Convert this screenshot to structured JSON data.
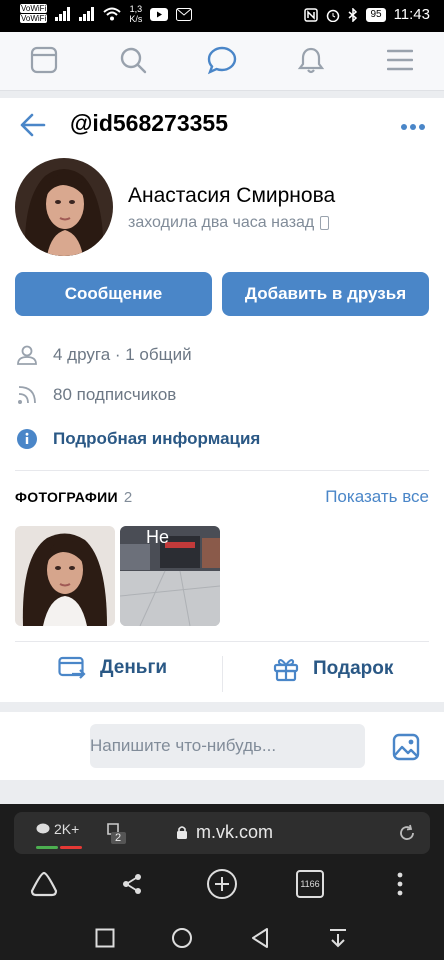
{
  "status": {
    "wifi_tag_1": "VoWiFi",
    "wifi_tag_2": "VoWiFi",
    "net_speed": "1,3",
    "net_speed_unit": "K/s",
    "battery": "95",
    "time": "11:43"
  },
  "profile": {
    "handle": "@id568273355",
    "name": "Анастасия Смирнова",
    "last_seen": "заходила два часа назад",
    "message_button": "Сообщение",
    "add_friend_button": "Добавить в друзья",
    "friends": "4 друга · 1 общий",
    "followers": "80 подписчиков",
    "details_link": "Подробная информация"
  },
  "photos": {
    "title": "ФОТОГРАФИИ",
    "count": "2",
    "show_all": "Показать все",
    "thumb2_overlay": "He"
  },
  "actions": {
    "money": "Деньги",
    "gift": "Подарок"
  },
  "composer": {
    "placeholder": "Напишите что-нибудь..."
  },
  "browser": {
    "tabs_count": "2K+",
    "group_count": "2",
    "url": "m.vk.com",
    "tab_counter": "1166"
  },
  "colors": {
    "accent": "#4a86c8",
    "link": "#2a5885",
    "muted": "#818c99"
  }
}
